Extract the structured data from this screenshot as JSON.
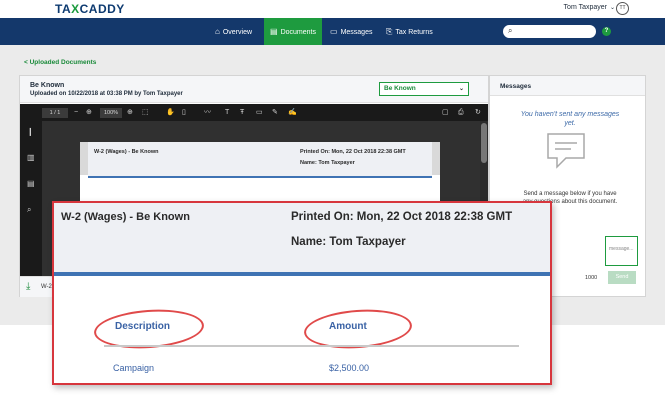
{
  "app": {
    "logo_text_a": "TA",
    "logo_text_b": "X",
    "logo_text_c": "CADDY",
    "user_name": "Tom Taxpayer",
    "user_initials": "TT"
  },
  "nav": {
    "items": [
      {
        "label": "Overview",
        "icon": "home-icon"
      },
      {
        "label": "Documents",
        "icon": "document-icon",
        "active": true
      },
      {
        "label": "Messages",
        "icon": "chat-icon"
      },
      {
        "label": "Tax Returns",
        "icon": "tax-return-icon"
      }
    ],
    "help_label": "?"
  },
  "breadcrumb": {
    "back_label": "< Uploaded Documents"
  },
  "document": {
    "title": "Be Known",
    "subtitle": "Uploaded on 10/22/2018 at 03:38 PM by Tom Taxpayer",
    "selector_value": "Be Known",
    "footer_filename": "W-2"
  },
  "viewer": {
    "page_indicator": "1 / 1",
    "zoom_level": "100%"
  },
  "paper": {
    "title": "W-2 (Wages) - Be Known",
    "printed_on": "Printed On: Mon, 22 Oct 2018 22:38 GMT",
    "name_line": "Name: Tom Taxpayer"
  },
  "messages": {
    "title": "Messages",
    "empty_text": "You haven't sent any messages yet.",
    "help_text": "Send a message below if you have any questions about this document.",
    "input_placeholder": "message...",
    "char_count": "1000",
    "send_label": "Send"
  },
  "zoom_callout": {
    "title": "W-2 (Wages) - Be Known",
    "printed_on": "Printed On: Mon, 22 Oct 2018 22:38 GMT",
    "name_line": "Name: Tom Taxpayer",
    "columns": [
      "Description",
      "Amount"
    ],
    "rows": [
      {
        "description": "Campaign",
        "amount": "$2,500.00"
      }
    ]
  },
  "colors": {
    "nav_bg": "#14386b",
    "accent_green": "#1e9b3f",
    "header_blue_rule": "#3f73b3",
    "highlight_red": "#d7363d"
  }
}
